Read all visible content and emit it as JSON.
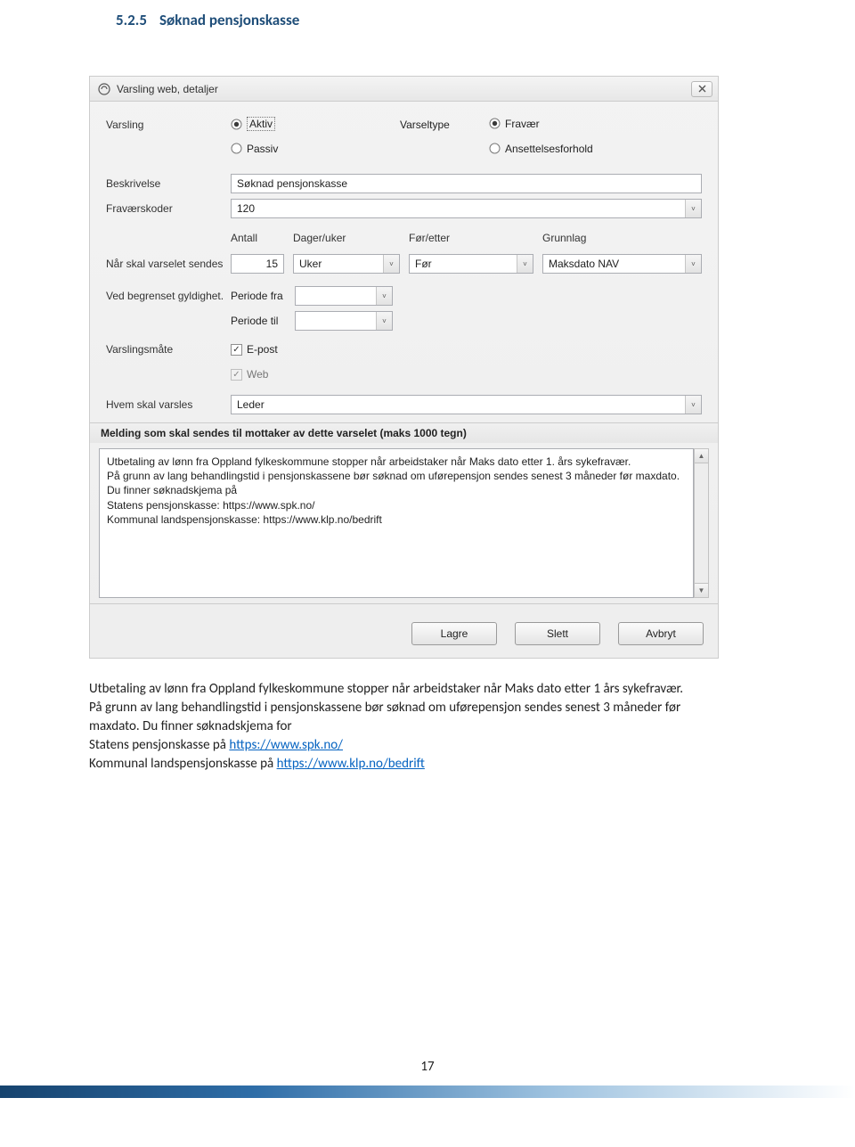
{
  "heading": {
    "number": "5.2.5",
    "title": "Søknad pensjonskasse"
  },
  "window": {
    "title": "Varsling web, detaljer",
    "labels": {
      "varsling": "Varsling",
      "varseltype": "Varseltype",
      "beskrivelse": "Beskrivelse",
      "fravaerskoder": "Fraværskoder",
      "antall": "Antall",
      "dager_uker": "Dager/uker",
      "for_etter": "Før/etter",
      "grunnlag": "Grunnlag",
      "nar_sendes": "Når skal varselet sendes",
      "ved_begrenset": "Ved begrenset gyldighet.",
      "periode_fra": "Periode fra",
      "periode_til": "Periode til",
      "varslingsmate": "Varslingsmåte",
      "hvem_varsles": "Hvem skal varsles",
      "melding_hdr": "Melding som skal sendes til mottaker av dette varselet (maks 1000 tegn)"
    },
    "varsling": {
      "aktiv": "Aktiv",
      "passiv": "Passiv",
      "selected": "aktiv"
    },
    "varseltype": {
      "fravaer": "Fravær",
      "ansettelse": "Ansettelsesforhold",
      "selected": "fravaer"
    },
    "beskrivelse_value": "Søknad pensjonskasse",
    "fravaerskoder_value": "120",
    "antall_value": "15",
    "dager_uker_value": "Uker",
    "for_etter_value": "Før",
    "grunnlag_value": "Maksdato NAV",
    "periode_fra_value": "",
    "periode_til_value": "",
    "varslingsmate": {
      "epost": "E-post",
      "web": "Web",
      "epost_checked": true,
      "web_checked": true
    },
    "hvem_varsles_value": "Leder",
    "melding_text": "Utbetaling av lønn fra Oppland fylkeskommune stopper når arbeidstaker når Maks dato etter 1. års sykefravær.\nPå grunn av lang behandlingstid i pensjonskassene bør søknad om uførepensjon sendes senest 3 måneder før maxdato.\nDu finner søknadskjema på\nStatens pensjonskasse: https://www.spk.no/\nKommunal landspensjonskasse: https://www.klp.no/bedrift",
    "buttons": {
      "lagre": "Lagre",
      "slett": "Slett",
      "avbryt": "Avbryt"
    }
  },
  "body": {
    "p1": "Utbetaling av lønn fra Oppland fylkeskommune stopper når arbeidstaker når Maks dato etter 1 års sykefravær.",
    "p2": "På grunn av lang behandlingstid i pensjonskassene bør søknad om uførepensjon sendes senest 3 måneder før maxdato. Du finner søknadskjema for",
    "p3a": "Statens pensjonskasse på ",
    "link1": "https://www.spk.no/",
    "p4a": "Kommunal landspensjonskasse på ",
    "link2": "https://www.klp.no/bedrift"
  },
  "page_number": "17"
}
